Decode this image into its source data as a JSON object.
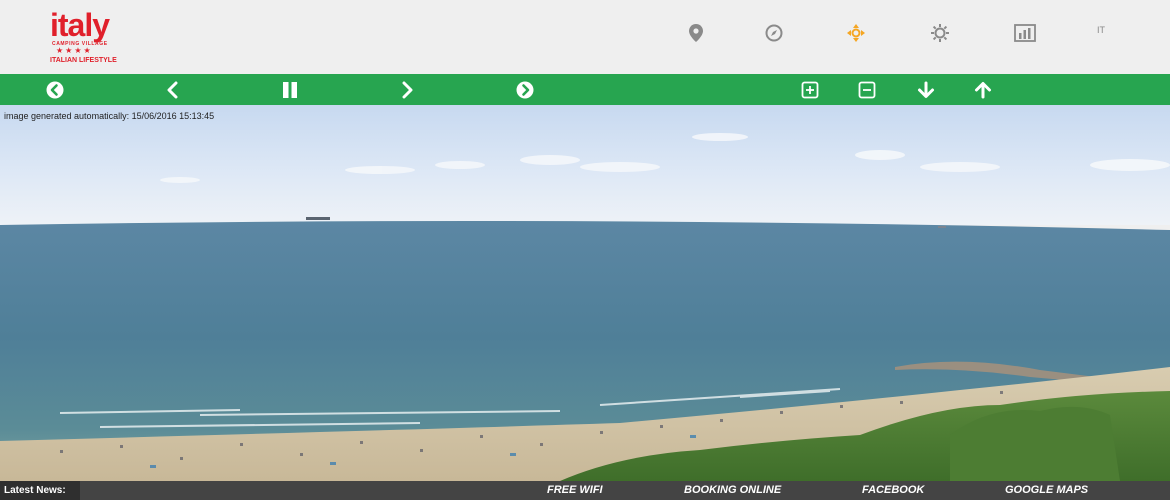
{
  "brand": {
    "name": "italy",
    "subtitle": "CAMPING VILLAGE",
    "stars": "★★★★",
    "tagline": "ITALIAN LIFESTYLE",
    "color": "#e0202b"
  },
  "top_nav": {
    "icons": [
      "location-icon",
      "compass-icon",
      "move-icon",
      "brightness-icon",
      "stats-icon"
    ],
    "active_icon": "move-icon",
    "active_color": "#f5a623",
    "language": "IT"
  },
  "toolbar": {
    "color": "#27a550",
    "buttons": [
      "first-icon",
      "prev-icon",
      "pause-icon",
      "next-icon",
      "last-icon",
      "zoom-in-icon",
      "zoom-out-icon",
      "down-icon",
      "up-icon"
    ]
  },
  "camera": {
    "caption": "image generated automatically: 15/06/2016 15:13:45"
  },
  "footer": {
    "news_label": "Latest News:",
    "links": [
      "FREE WIFI",
      "BOOKING ONLINE",
      "FACEBOOK",
      "GOOGLE MAPS"
    ]
  }
}
